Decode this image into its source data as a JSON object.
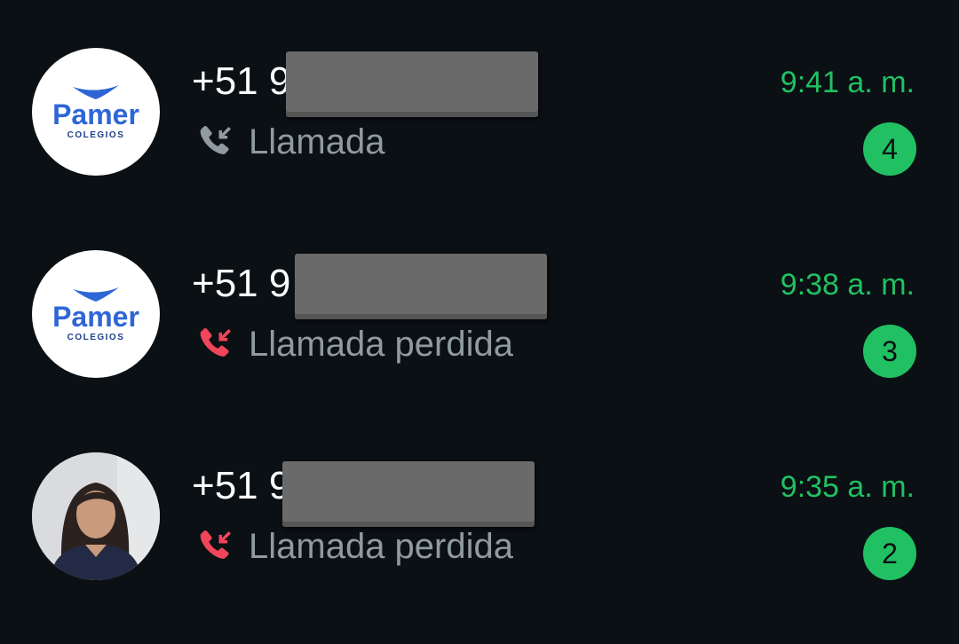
{
  "chats": [
    {
      "avatar": "pamer-logo",
      "logo_text": "Pamer",
      "logo_sub": "COLEGIOS",
      "title": "+51 9",
      "call_icon": "incoming-call-icon",
      "call_label": "Llamada",
      "missed": false,
      "time": "9:41 a. m.",
      "unread": "4"
    },
    {
      "avatar": "pamer-logo",
      "logo_text": "Pamer",
      "logo_sub": "COLEGIOS",
      "title": "+51 9",
      "call_icon": "missed-call-icon",
      "call_label": "Llamada perdida",
      "missed": true,
      "time": "9:38 a. m.",
      "unread": "3"
    },
    {
      "avatar": "person-photo",
      "title": "+51 9",
      "call_icon": "missed-call-icon",
      "call_label": "Llamada perdida",
      "missed": true,
      "time": "9:35 a. m.",
      "unread": "2"
    }
  ],
  "colors": {
    "background": "#0b1014",
    "accent": "#21c063",
    "missed": "#f0455a",
    "muted": "#8f9aa1",
    "redaction": "#6a6a6a"
  }
}
